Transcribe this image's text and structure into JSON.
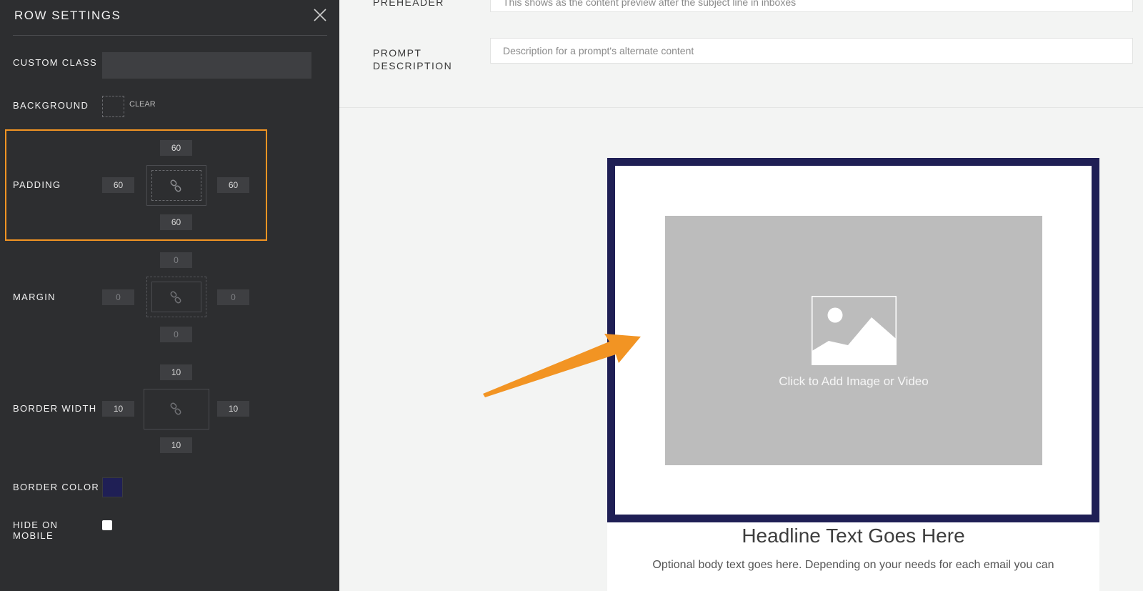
{
  "sidebar": {
    "title": "ROW SETTINGS",
    "custom_class": {
      "label": "CUSTOM CLASS",
      "value": ""
    },
    "background": {
      "label": "BACKGROUND",
      "clear_label": "CLEAR"
    },
    "padding": {
      "label": "PADDING",
      "top": "60",
      "left": "60",
      "right": "60",
      "bottom": "60"
    },
    "margin": {
      "label": "MARGIN",
      "top": "0",
      "left": "0",
      "right": "0",
      "bottom": "0"
    },
    "border_width": {
      "label": "BORDER WIDTH",
      "top": "10",
      "left": "10",
      "right": "10",
      "bottom": "10"
    },
    "border_color": {
      "label": "BORDER COLOR",
      "color": "#1f1f55"
    },
    "hide_on_mobile": {
      "label_line1": "HIDE ON",
      "label_line2": "MOBILE",
      "checked": false
    },
    "highlight_color": "#f29423"
  },
  "main": {
    "preheader": {
      "label": "PREHEADER",
      "placeholder": "This shows as the content preview after the subject line in inboxes"
    },
    "prompt_description": {
      "label_line1": "PROMPT",
      "label_line2": "DESCRIPTION",
      "placeholder": "Description for a prompt's alternate content"
    },
    "image_placeholder": {
      "caption": "Click to Add Image or Video",
      "icon": "image-icon"
    },
    "headline": "Headline Text Goes Here",
    "body_text": "Optional body text goes here. Depending on your needs for each email you can"
  }
}
